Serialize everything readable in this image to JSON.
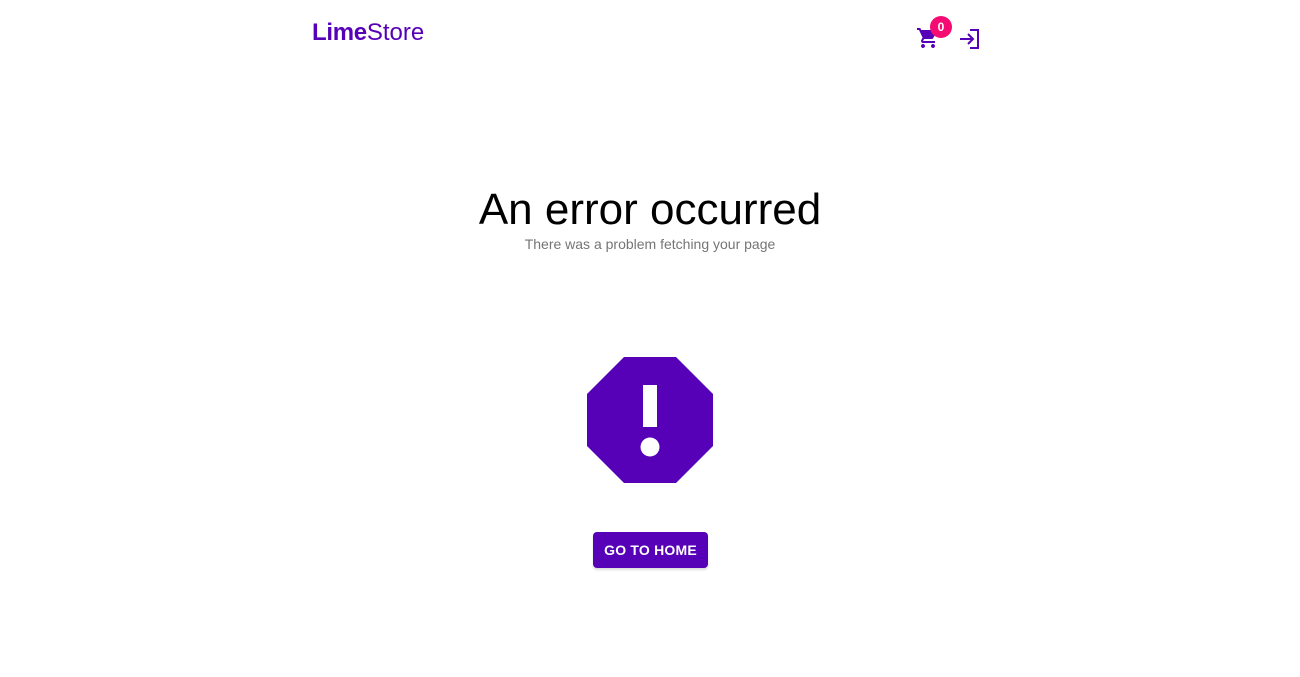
{
  "header": {
    "logo_bold": "Lime",
    "logo_light": "Store",
    "cart_count": "0",
    "cart_icon": "shopping-cart-icon",
    "login_icon": "login-icon"
  },
  "main": {
    "title": "An error occurred",
    "subtitle": "There was a problem fetching your page",
    "error_icon": "octagon-alert-icon",
    "home_button_label": "GO TO HOME"
  },
  "colors": {
    "brand": "#5600b8",
    "badge": "#f50b72",
    "subtitle_text": "#757575"
  }
}
